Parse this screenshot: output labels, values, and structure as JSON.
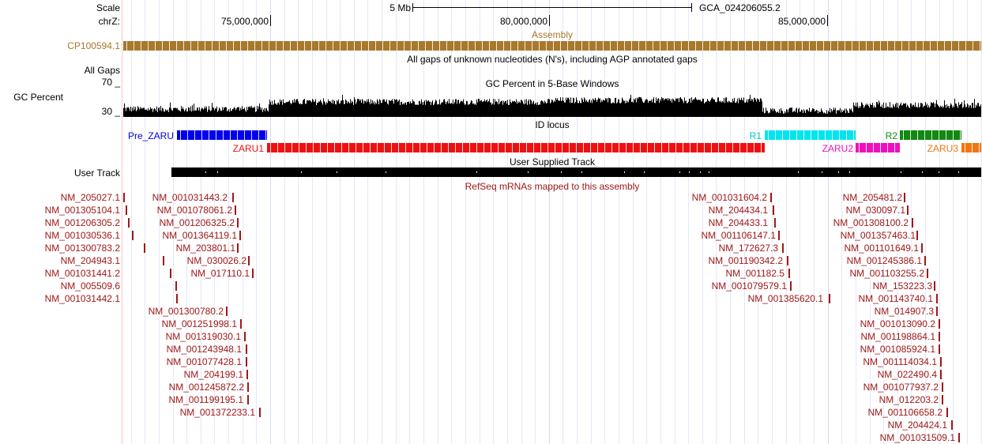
{
  "ruler": {
    "scale_label": "Scale",
    "chrom_label": "chrZ:",
    "scale_text": "5 Mb",
    "assembly_name": "GCA_024206055.2",
    "positions": [
      "75,000,000",
      "80,000,000",
      "85,000,000"
    ]
  },
  "assembly_track": {
    "left_label": "CP100594.1",
    "center_label": "Assembly",
    "color": "#a8782c"
  },
  "gaps_track": {
    "title": "All gaps of unknown nucleotides (N's), including AGP annotated gaps",
    "left_label": "All Gaps"
  },
  "gc_track": {
    "title": "GC Percent in 5-Base Windows",
    "left_label": "GC Percent",
    "max_label": "70 _",
    "min_label": "30 _"
  },
  "id_locus": {
    "title": "ID locus",
    "features": [
      {
        "name": "Pre_ZARU",
        "color": "#0000ee"
      },
      {
        "name": "ZARU1",
        "color": "#ee1111"
      },
      {
        "name": "R1",
        "color": "#00e5ee"
      },
      {
        "name": "ZARU2",
        "color": "#ee11bb"
      },
      {
        "name": "R2",
        "color": "#118811"
      },
      {
        "name": "ZARU3",
        "color": "#ee7711"
      }
    ]
  },
  "user_track": {
    "title": "User Supplied Track",
    "left_label": "User Track"
  },
  "refseq": {
    "title": "RefSeq mRNAs mapped to this assembly",
    "color": "#a01818",
    "groups": [
      [
        "NM_205027.1",
        "NM_001305104.1",
        "NM_001206305.2",
        "NM_001030536.1",
        "NM_001300783.2",
        "NM_204943.1",
        "NM_001031441.2",
        "NM_005509.6",
        "NM_001031442.1"
      ],
      [
        "NM_001031443.2",
        "NM_001078061.2",
        "NM_001206325.2",
        "NM_001364119.1",
        "NM_203801.1",
        "NM_030026.2",
        "NM_017110.1",
        "NM_001300780.2",
        "NM_001251998.1",
        "NM_001319030.1",
        "NM_001243948.1",
        "NM_001077428.1",
        "NM_204199.1",
        "NM_001245872.2",
        "NM_001199195.1",
        "NM_001372233.1"
      ],
      [
        "NM_001031604.2",
        "NM_204434.1",
        "NM_204433.1",
        "NM_001106147.1",
        "NM_172627.3",
        "NM_001190342.2",
        "NM_001182.5",
        "NM_001079579.1",
        "NM_001385620.1"
      ],
      [
        "NM_205481.2",
        "NM_030097.1",
        "NM_001308100.2",
        "NM_001357463.1",
        "NM_001101649.1",
        "NM_001245386.1",
        "NM_001103255.2",
        "NM_153223.3",
        "NM_001143740.1",
        "NM_014907.3",
        "NM_001013090.2",
        "NM_001198864.1",
        "NM_001085924.1",
        "NM_001114034.1",
        "NM_022490.4",
        "NM_001077937.2",
        "NM_012203.2",
        "NM_001106658.2",
        "NM_204424.1",
        "NM_001031509.1"
      ]
    ]
  }
}
